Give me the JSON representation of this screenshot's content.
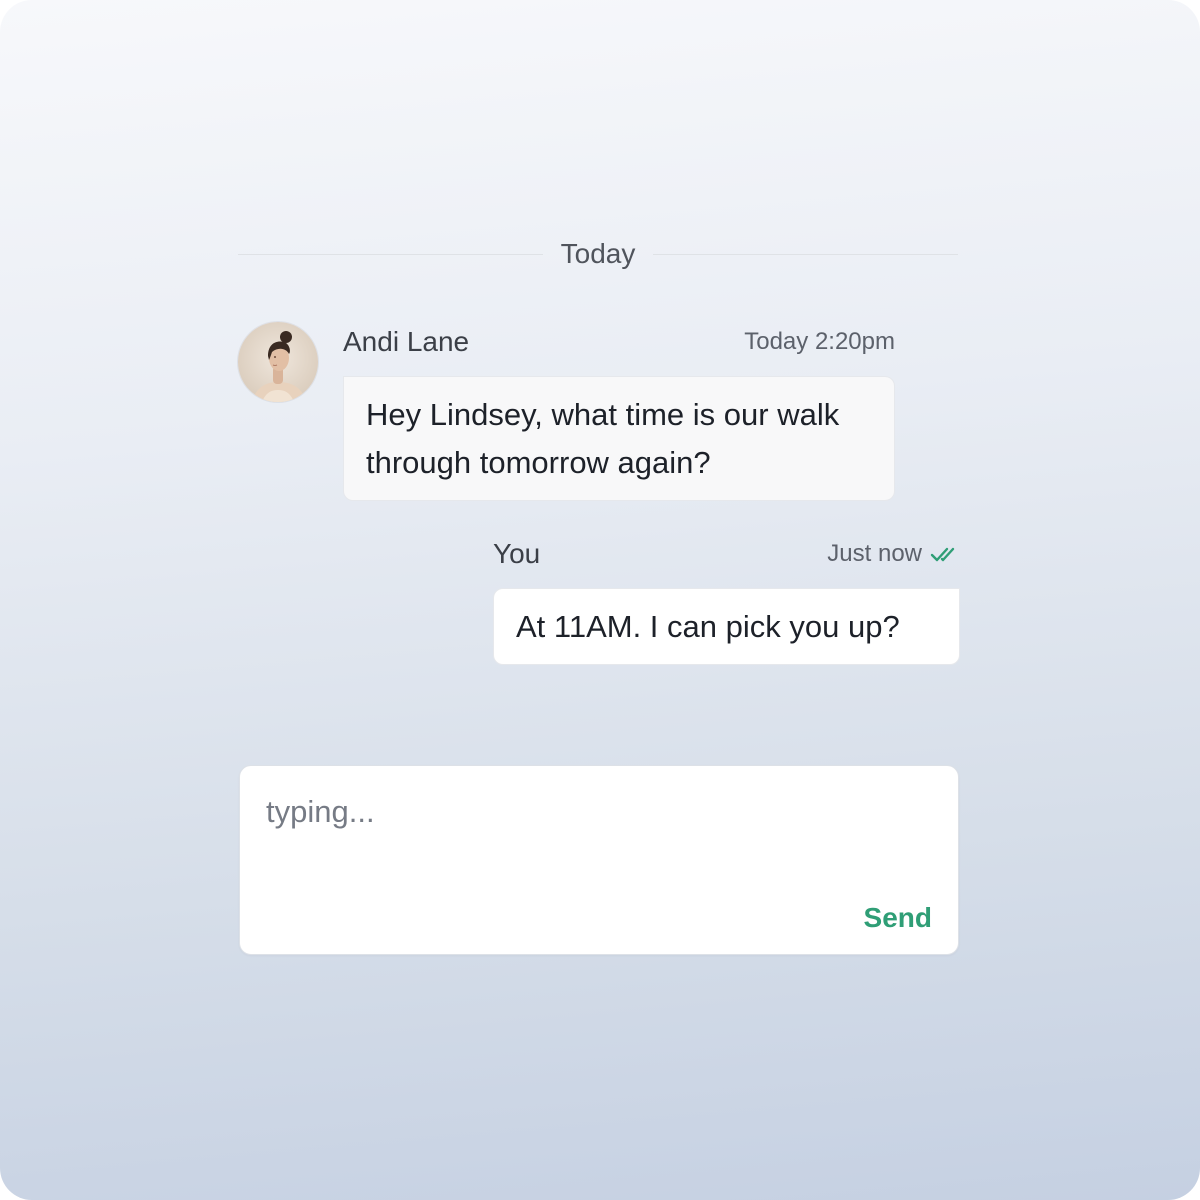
{
  "divider": {
    "label": "Today"
  },
  "messages": [
    {
      "sender": "Andi Lane",
      "timestamp": "Today 2:20pm",
      "text": "Hey Lindsey, what time is our walk through tomorrow again?",
      "avatar": "avatar-photo"
    },
    {
      "sender": "You",
      "timestamp": "Just now",
      "text": "At 11AM. I can pick you up?",
      "status_icon": "double-check-icon"
    }
  ],
  "composer": {
    "placeholder": "typing...",
    "value": "",
    "send_label": "Send"
  },
  "colors": {
    "accent": "#2f9e76",
    "bubble_incoming": "#f8f8f9",
    "bubble_outgoing": "#ffffff",
    "text_primary": "#1d2129",
    "text_secondary": "#5c616b"
  }
}
